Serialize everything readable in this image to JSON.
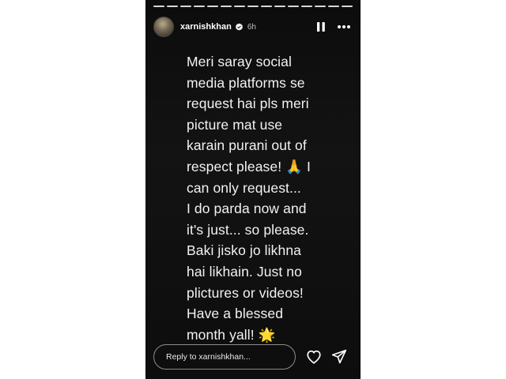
{
  "story": {
    "progress_segments": 15,
    "user": {
      "username": "xarnishkhan",
      "time": "6h",
      "verified": true
    },
    "message": "Meri saray social\nmedia platforms se\nrequest hai pls meri\npicture mat use\nkarain purani out of\nrespect please! 🙏 I\ncan only request...\nI do parda now and\nit's just... so please.\nBaki jisko jo likhna\nhai likhain. Just no\nplictures or videos!\nHave a blessed\nmonth yall! 🌟",
    "reply": {
      "placeholder": "Reply to xarnishkhan..."
    },
    "icons": {
      "pause": "pause-icon",
      "more": "more-icon",
      "heart": "heart-icon",
      "send": "send-icon",
      "verified": "verified-badge-icon"
    },
    "colors": {
      "background": "#0f0f0f",
      "text": "#f2f2f2",
      "border": "#8d8d8d"
    }
  }
}
